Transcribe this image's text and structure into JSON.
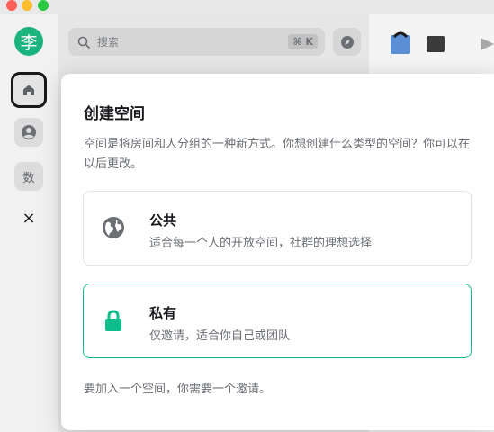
{
  "window": {
    "controls": [
      "close",
      "minimize",
      "zoom"
    ]
  },
  "rail": {
    "user_avatar": "李",
    "items": [
      {
        "name": "home",
        "icon": "home-icon"
      },
      {
        "name": "people",
        "icon": "people-icon"
      },
      {
        "name": "space",
        "label": "数"
      }
    ],
    "close_symbol": "×"
  },
  "search": {
    "placeholder": "搜索",
    "shortcut": "⌘ K"
  },
  "dialog": {
    "title": "创建空间",
    "description": "空间是将房间和人分组的一种新方式。你想创建什么类型的空间？你可以在以后更改。",
    "options": [
      {
        "name": "公共",
        "description": "适合每一个人的开放空间，社群的理想选择",
        "icon": "globe-icon"
      },
      {
        "name": "私有",
        "description": "仅邀请，适合你自己或团队",
        "icon": "lock-icon"
      }
    ],
    "footer": "要加入一个空间，你需要一个邀请。"
  },
  "colors": {
    "accent": "#0dbd8b",
    "avatar": "#1cb37e"
  }
}
